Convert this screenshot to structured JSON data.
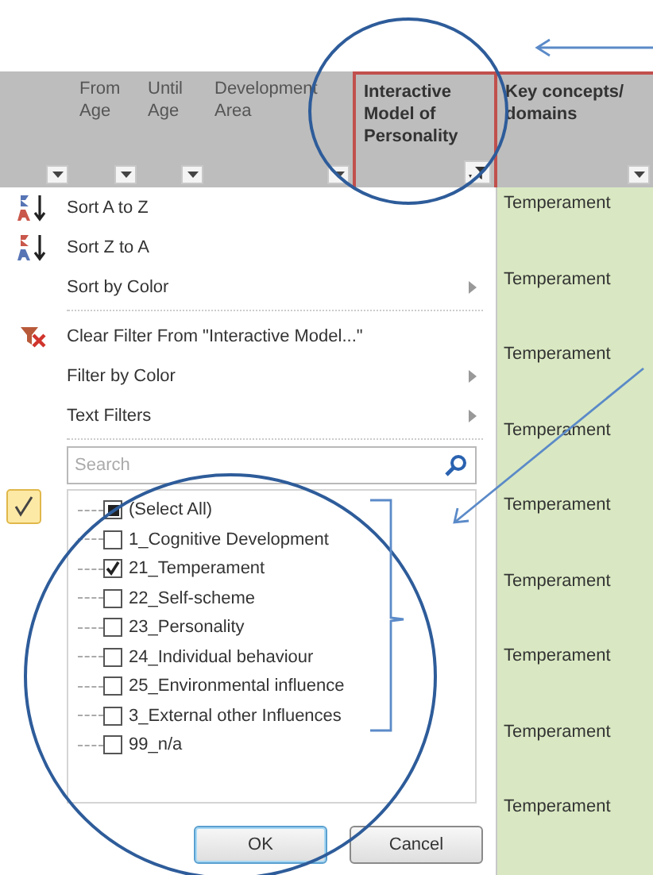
{
  "columns": [
    {
      "filtered": false,
      "highlighted": false
    },
    {
      "label": "From Age",
      "filtered": false,
      "highlighted": false
    },
    {
      "label": "Until Age",
      "filtered": false,
      "highlighted": false
    },
    {
      "label": "Development Area",
      "filtered": false,
      "highlighted": false
    },
    {
      "label": "Interactive Model of Personality",
      "filtered": true,
      "highlighted": true
    },
    {
      "label": "Key concepts/ domains",
      "filtered": false,
      "highlighted": true
    }
  ],
  "menu": [
    {
      "kind": "ascending",
      "label": "Sort A to Z",
      "submenu": false
    },
    {
      "kind": "descending",
      "label": "Sort Z to A",
      "submenu": false
    },
    {
      "kind": "item",
      "label": "Sort by Color",
      "submenu": true
    },
    {
      "kind": "separator"
    },
    {
      "kind": "clearing",
      "label": "Clear Filter From \"Interactive Model...\"",
      "submenu": false
    },
    {
      "kind": "item",
      "label": "Filter by Color",
      "submenu": true
    },
    {
      "kind": "item",
      "label": "Text Filters",
      "submenu": true
    },
    {
      "kind": "separator"
    }
  ],
  "search": {
    "placeholder": "Search"
  },
  "values": [
    {
      "label": "(Select All)",
      "checked": true,
      "partial": true
    },
    {
      "label": "1_Cognitive Development",
      "checked": false
    },
    {
      "label": "21_Temperament",
      "checked": true
    },
    {
      "label": "22_Self-scheme",
      "checked": false
    },
    {
      "label": "23_Personality",
      "checked": false
    },
    {
      "label": "24_Individual behaviour",
      "checked": false
    },
    {
      "label": "25_Environmental influence",
      "checked": false
    },
    {
      "label": "3_External other Influences",
      "checked": false
    },
    {
      "label": "99_n/a",
      "checked": false
    }
  ],
  "buttons": [
    {
      "label": "OK",
      "default": true
    },
    {
      "label": "Cancel",
      "default": false
    }
  ],
  "cells": [
    "Temperament",
    "Temperament",
    "Temperament",
    "Temperament",
    "Temperament",
    "Temperament",
    "Temperament",
    "Temperament",
    "Temperament"
  ]
}
